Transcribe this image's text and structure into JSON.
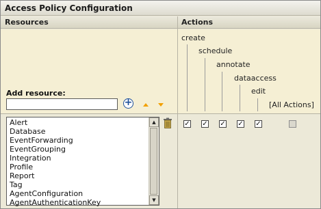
{
  "title": "Access Policy Configuration",
  "columns": {
    "resources": "Resources",
    "actions": "Actions"
  },
  "add_resource": {
    "label": "Add resource:",
    "value": "",
    "placeholder": ""
  },
  "actions_tree": [
    "create",
    "schedule",
    "annotate",
    "dataaccess",
    "edit",
    "[All Actions]"
  ],
  "resource_list": [
    "Alert",
    "Database",
    "EventForwarding",
    "EventGrouping",
    "Integration",
    "Profile",
    "Report",
    "Tag",
    "AgentConfiguration",
    "AgentAuthenticationKey"
  ],
  "checkboxes": [
    {
      "action": "create",
      "checked": true
    },
    {
      "action": "schedule",
      "checked": true
    },
    {
      "action": "annotate",
      "checked": true
    },
    {
      "action": "dataaccess",
      "checked": true
    },
    {
      "action": "edit",
      "checked": true
    },
    {
      "action": "[All Actions]",
      "checked": false,
      "disabled": true
    }
  ],
  "colors": {
    "accent": "#1d4f99",
    "arrow": "#f2a000",
    "panel_bg": "#f5efd4"
  },
  "icons": {
    "add": "plus-circle-icon",
    "move_up": "arrow-up-icon",
    "move_down": "arrow-down-icon",
    "delete": "trash-icon",
    "check": "check-icon"
  }
}
